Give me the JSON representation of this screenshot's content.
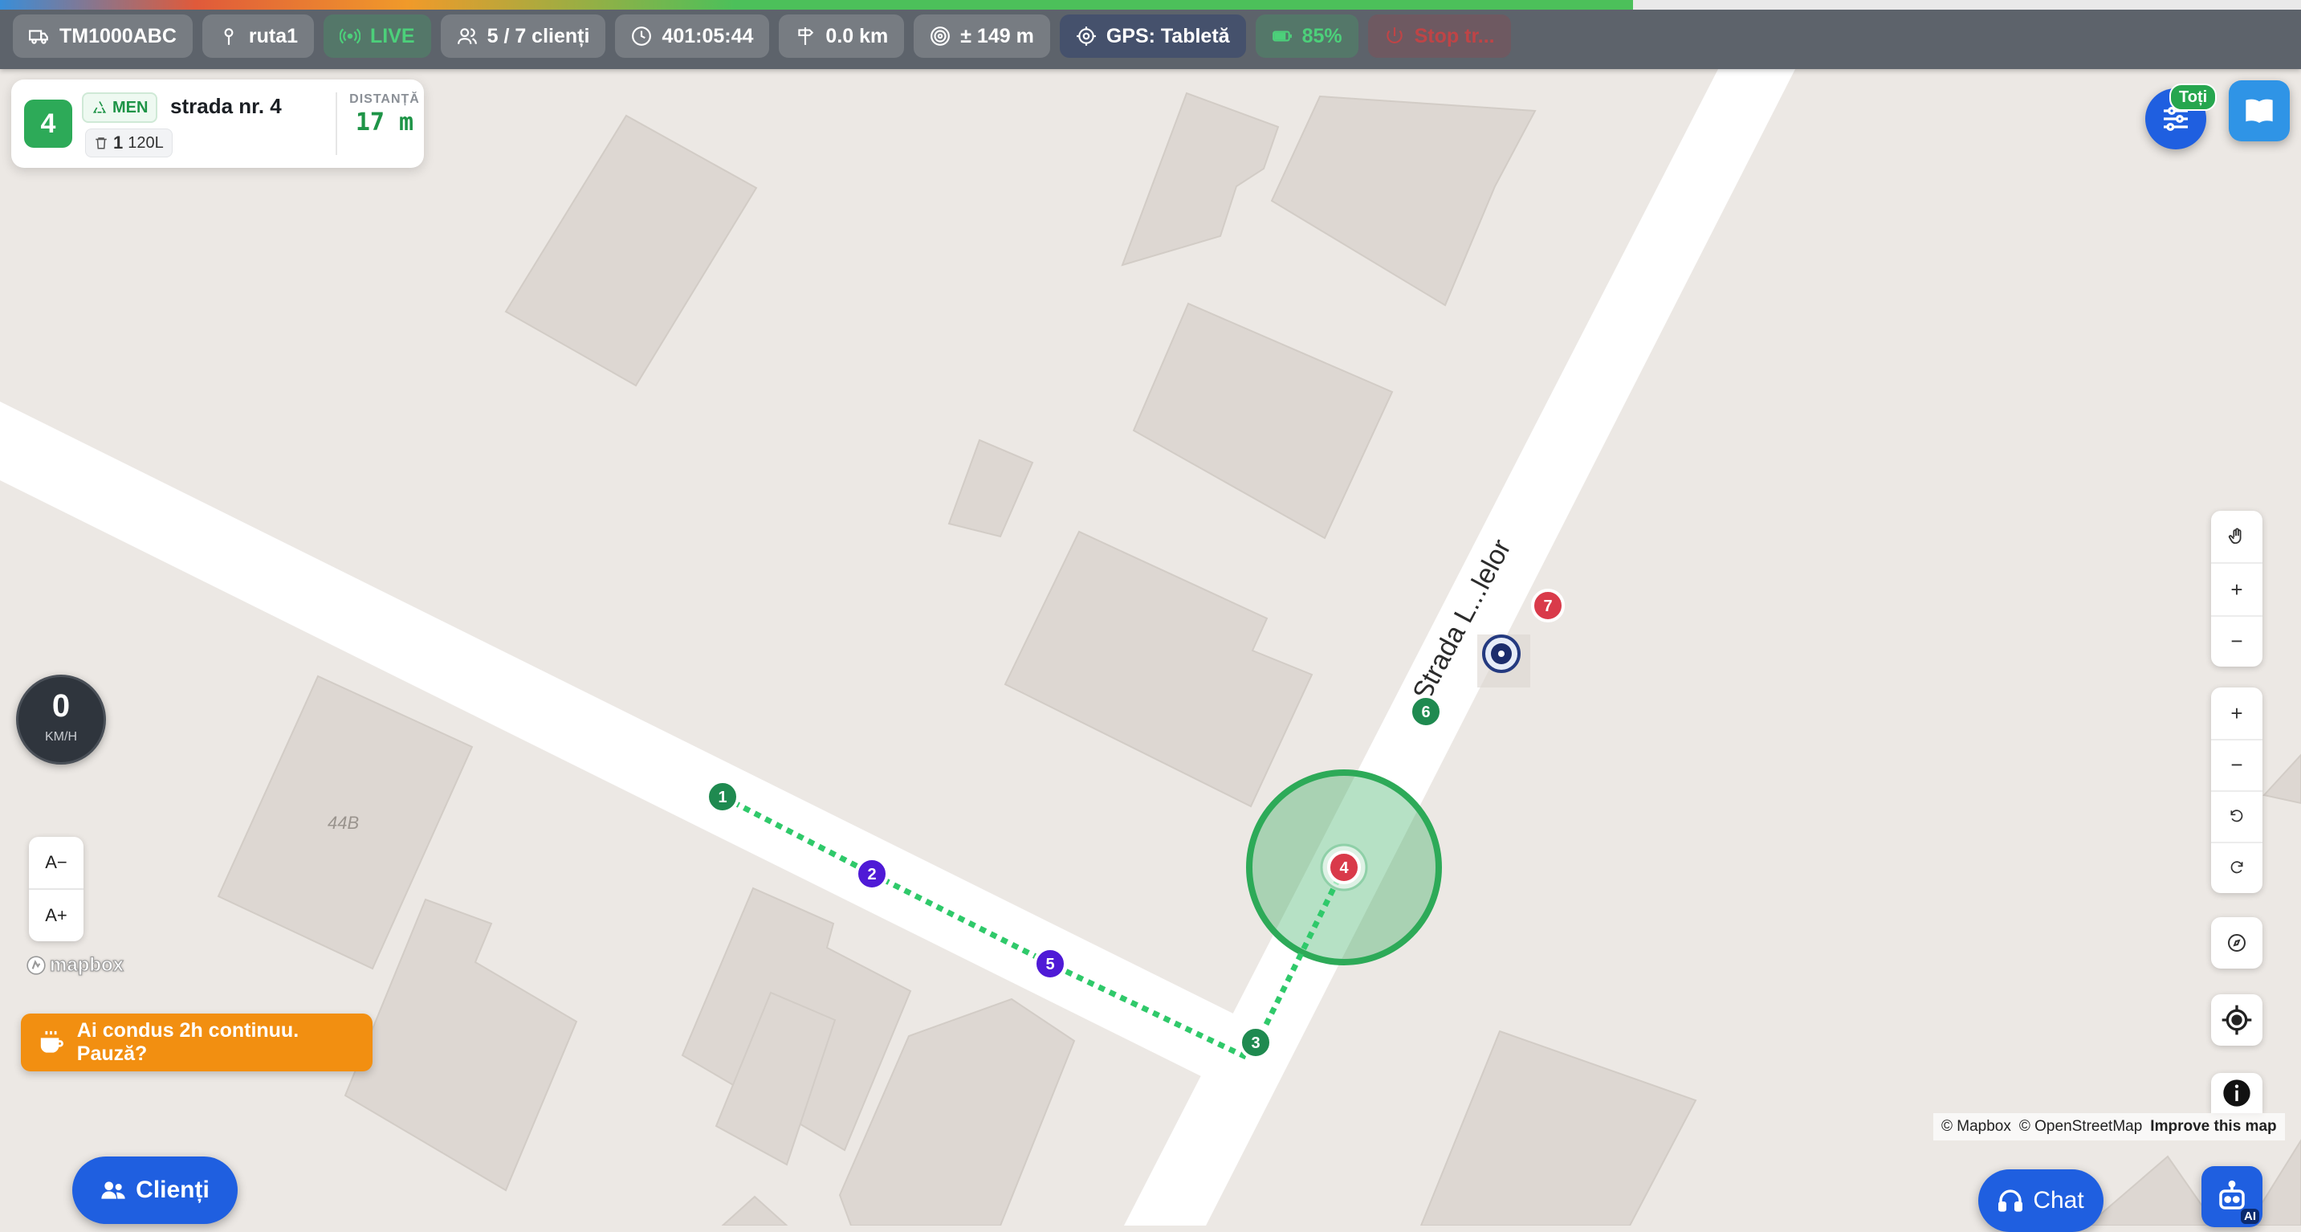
{
  "topbar": {
    "vehicle": "TM1000ABC",
    "route": "ruta1",
    "live": "LIVE",
    "clients": "5 / 7 clienți",
    "timer": "401:05:44",
    "distance": "0.0 km",
    "accuracy": "± 149 m",
    "gps": "GPS: Tabletă",
    "battery": "85%",
    "stop": "Stop tr..."
  },
  "card": {
    "stop_number": "4",
    "waste_type": "MEN",
    "street": "strada nr. 4",
    "bin_count": "1",
    "bin_size": "120L",
    "distance_label": "DISTANȚĂ",
    "distance_value": "17 m"
  },
  "map": {
    "street_name": "Strada L...lelor",
    "building_number": "44B",
    "markers": [
      {
        "label": "1",
        "status": "done"
      },
      {
        "label": "2",
        "status": "skipped"
      },
      {
        "label": "3",
        "status": "done"
      },
      {
        "label": "4",
        "status": "current"
      },
      {
        "label": "5",
        "status": "skipped"
      },
      {
        "label": "6",
        "status": "done"
      },
      {
        "label": "7",
        "status": "pending"
      }
    ],
    "colors": {
      "done": "#1f8a50",
      "skipped": "#4f1ad6",
      "pending": "#d93a4a",
      "route": "#2fc96a",
      "zone": "#2daa58"
    }
  },
  "speed": {
    "value": "0",
    "unit": "KM/H"
  },
  "font_controls": {
    "decrease": "A−",
    "increase": "A+"
  },
  "mapbox_logo": "mapbox",
  "pause_alert": "Ai condus 2h continuu. Pauză?",
  "filter_badge": "Toți",
  "clients_button": "Clienți",
  "attribution": {
    "mapbox": "© Mapbox",
    "osm": "© OpenStreetMap",
    "improve": "Improve this map"
  },
  "chat_button": "Chat",
  "ai_tag": "AI"
}
